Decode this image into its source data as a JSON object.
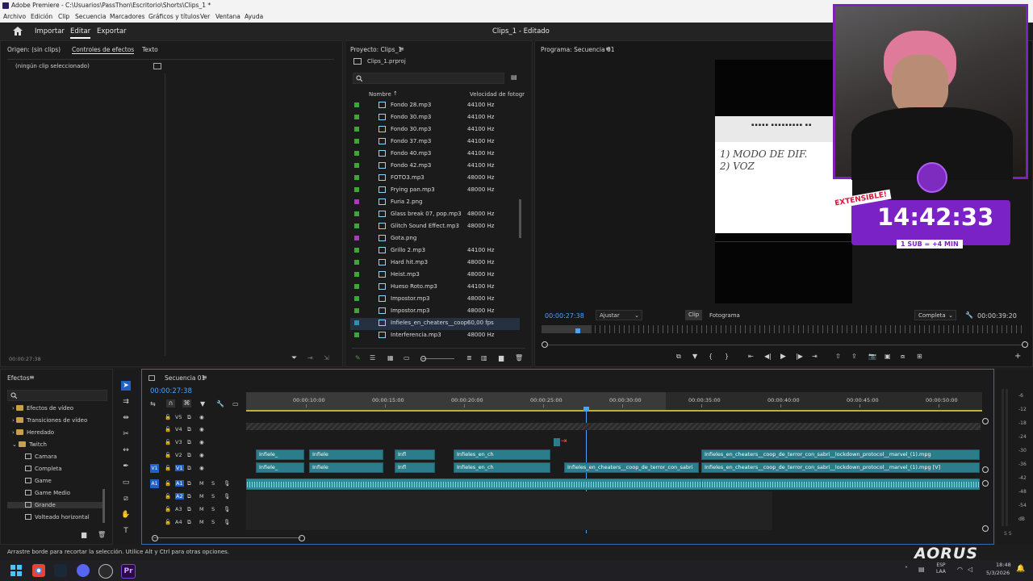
{
  "window": {
    "title": "Adobe Premiere - C:\\Usuarios\\PassThon\\Escritorio\\Shorts\\Clips_1 *"
  },
  "menu": [
    "Archivo",
    "Edición",
    "Clip",
    "Secuencia",
    "Marcadores",
    "Gráficos y títulos",
    "Ver",
    "Ventana",
    "Ayuda"
  ],
  "workspace": {
    "import": "Importar",
    "edit": "Editar",
    "export": "Exportar",
    "doc_title": "Clips_1 - Editado"
  },
  "source_panel": {
    "tabs": [
      "Origen: (sin clips)",
      "Controles de efectos",
      "Texto"
    ],
    "empty": "(ningún clip seleccionado)",
    "timecode": "00:00:27:38"
  },
  "project": {
    "title": "Proyecto: Clips_1",
    "file": "Clips_1.prproj",
    "col_name": "Nombre",
    "col_rate": "Velocidad de fotogr",
    "items": [
      {
        "name": "Fondo 28.mp3",
        "rate": "44100 Hz",
        "color": "#3fa53a"
      },
      {
        "name": "Fondo 30.mp3",
        "rate": "44100 Hz",
        "color": "#3fa53a"
      },
      {
        "name": "Fondo 30.mp3",
        "rate": "44100 Hz",
        "color": "#3fa53a"
      },
      {
        "name": "Fondo 37.mp3",
        "rate": "44100 Hz",
        "color": "#3fa53a"
      },
      {
        "name": "Fondo 40.mp3",
        "rate": "44100 Hz",
        "color": "#3fa53a"
      },
      {
        "name": "Fondo 42.mp3",
        "rate": "44100 Hz",
        "color": "#3fa53a"
      },
      {
        "name": "FOTO3.mp3",
        "rate": "48000 Hz",
        "color": "#3fa53a"
      },
      {
        "name": "Frying pan.mp3",
        "rate": "48000 Hz",
        "color": "#3fa53a"
      },
      {
        "name": "Furia 2.png",
        "rate": "",
        "color": "#a13fb5"
      },
      {
        "name": "Glass break 07, pop.mp3",
        "rate": "48000 Hz",
        "color": "#3fa53a"
      },
      {
        "name": "Glitch Sound Effect.mp3",
        "rate": "48000 Hz",
        "color": "#3fa53a"
      },
      {
        "name": "Gota.png",
        "rate": "",
        "color": "#a13fb5"
      },
      {
        "name": "Grillo 2.mp3",
        "rate": "44100 Hz",
        "color": "#3fa53a"
      },
      {
        "name": "Hard hit.mp3",
        "rate": "48000 Hz",
        "color": "#3fa53a"
      },
      {
        "name": "Heist.mp3",
        "rate": "48000 Hz",
        "color": "#3fa53a"
      },
      {
        "name": "Hueso Roto.mp3",
        "rate": "44100 Hz",
        "color": "#3fa53a"
      },
      {
        "name": "Impostor.mp3",
        "rate": "48000 Hz",
        "color": "#3fa53a"
      },
      {
        "name": "Impostor.mp3",
        "rate": "48000 Hz",
        "color": "#3fa53a"
      },
      {
        "name": "Infieles_en_cheaters__coop",
        "rate": "60,00 fps",
        "color": "#2a8fb0"
      },
      {
        "name": "Interferencia.mp3",
        "rate": "48000 Hz",
        "color": "#3fa53a"
      }
    ]
  },
  "program": {
    "title": "Programa: Secuencia 01",
    "timecode": "00:00:27:38",
    "fit": "Ajustar",
    "clip": "Clip",
    "frame": "Fotograma",
    "quality": "Completa",
    "duration": "00:00:39:20",
    "whiteboard": "1) MODO DE DIF.\n2) VOZ"
  },
  "overlay": {
    "badge": "EXTENSIBLE!",
    "timer": "14:42:33",
    "note": "1 SUB = +4 MIN",
    "brand": "AORUS"
  },
  "effects": {
    "title": "Efectos",
    "items": [
      {
        "label": "Efectos de vídeo",
        "kind": "folder",
        "indent": 0
      },
      {
        "label": "Transiciones de vídeo",
        "kind": "folder",
        "indent": 0
      },
      {
        "label": "Heredado",
        "kind": "folder",
        "indent": 0
      },
      {
        "label": "Twitch",
        "kind": "folder",
        "indent": 0
      },
      {
        "label": "Camara",
        "kind": "preset",
        "indent": 1
      },
      {
        "label": "Completa",
        "kind": "preset",
        "indent": 1
      },
      {
        "label": "Game",
        "kind": "preset",
        "indent": 1
      },
      {
        "label": "Game Medio",
        "kind": "preset",
        "indent": 1
      },
      {
        "label": "Grande",
        "kind": "preset",
        "indent": 1
      },
      {
        "label": "Volteado horizontal",
        "kind": "preset",
        "indent": 1
      }
    ]
  },
  "timeline": {
    "title": "Secuencia 01",
    "timecode": "00:00:27:38",
    "ruler": [
      "00:00:10:00",
      "00:00:15:00",
      "00:00:20:00",
      "00:00:25:00",
      "00:00:30:00",
      "00:00:35:00",
      "00:00:40:00",
      "00:00:45:00",
      "00:00:50:00"
    ],
    "tracks": [
      "V5",
      "V4",
      "V3",
      "V2",
      "V1",
      "A1",
      "A2",
      "A3",
      "A4"
    ],
    "clips": [
      {
        "label": "Infiele_",
        "track": "V2"
      },
      {
        "label": "Infiele",
        "track": "V2"
      },
      {
        "label": "Infl",
        "track": "V2"
      },
      {
        "label": "Infieles_en_ch",
        "track": "V2"
      },
      {
        "label": "Infieles_en_cheaters__coop_de_terror_con_sabri__lockdown_protocol__marvel_(1).mpg",
        "track": "V2"
      },
      {
        "label": "Infiele_",
        "track": "V1"
      },
      {
        "label": "Infiele",
        "track": "V1"
      },
      {
        "label": "Infl",
        "track": "V1"
      },
      {
        "label": "Infieles_en_ch",
        "track": "V1"
      },
      {
        "label": "Infieles_en_cheaters__coop_de_terror_con_sabri",
        "track": "V1"
      },
      {
        "label": "Infieles_en_cheaters__coop_de_terror_con_sabri__lockdown_protocol__marvel_(1).mpg [V]",
        "track": "V1"
      }
    ],
    "meter": [
      "-6",
      "-12",
      "-18",
      "-24",
      "-30",
      "-36",
      "-42",
      "-48",
      "-54",
      "dB"
    ]
  },
  "status": "Arrastre borde para recortar la selección. Utilice Alt y Ctrl para otras opciones.",
  "taskbar": {
    "lang": "ESP\nLAA",
    "time": "18:48",
    "date": "5/3/2026"
  }
}
